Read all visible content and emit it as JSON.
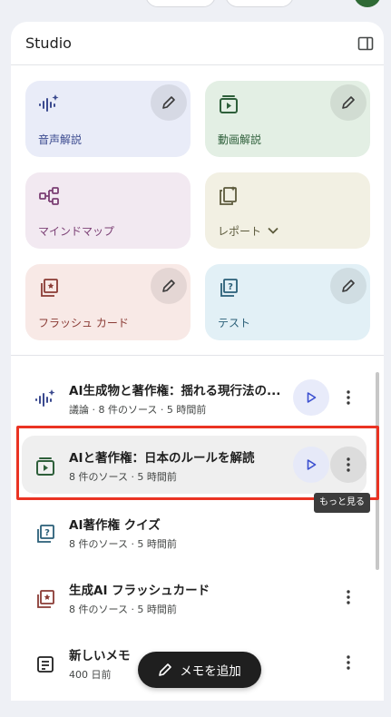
{
  "studio": {
    "title": "Studio"
  },
  "tiles": [
    {
      "label": "音声解説",
      "icon": "audio-waveform-icon",
      "color": "#3b4a8f",
      "bg": "#e9ecf8",
      "editable": true
    },
    {
      "label": "動画解説",
      "icon": "video-play-icon",
      "color": "#2e5f3a",
      "bg": "#e3efe4",
      "editable": true
    },
    {
      "label": "マインドマップ",
      "icon": "mindmap-icon",
      "color": "#7b3f74",
      "bg": "#f2e9f1",
      "editable": false
    },
    {
      "label": "レポート",
      "icon": "report-icon",
      "color": "#5c5a3c",
      "bg": "#f2f0e3",
      "editable": false
    },
    {
      "label": "フラッシュ カード",
      "icon": "flashcard-icon",
      "color": "#8a3b35",
      "bg": "#f8e9e6",
      "editable": true
    },
    {
      "label": "テスト",
      "icon": "quiz-icon",
      "color": "#2a5f78",
      "bg": "#e2f0f6",
      "editable": true
    }
  ],
  "items": [
    {
      "title": "AI生成物と著作権：揺れる現行法の...",
      "subtitle": "議論 · 8 件のソース · 5 時間前",
      "icon": "audio-waveform-icon",
      "playable": true
    },
    {
      "title": "AIと著作権：日本のルールを解読",
      "subtitle": "8 件のソース · 5 時間前",
      "icon": "video-play-icon",
      "playable": true
    },
    {
      "title": "AI著作権 クイズ",
      "subtitle": "8 件のソース · 5 時間前",
      "icon": "quiz-icon",
      "playable": false
    },
    {
      "title": "生成AI フラッシュカード",
      "subtitle": "8 件のソース · 5 時間前",
      "icon": "flashcard-icon",
      "playable": false
    },
    {
      "title": "新しいメモ",
      "subtitle": "400 日前",
      "icon": "note-icon",
      "playable": false
    }
  ],
  "tooltip": "もっと見る",
  "add_note": {
    "label": "メモを追加"
  },
  "colors": {
    "accent": "#3b4fd0",
    "highlight": "#ea3323"
  }
}
